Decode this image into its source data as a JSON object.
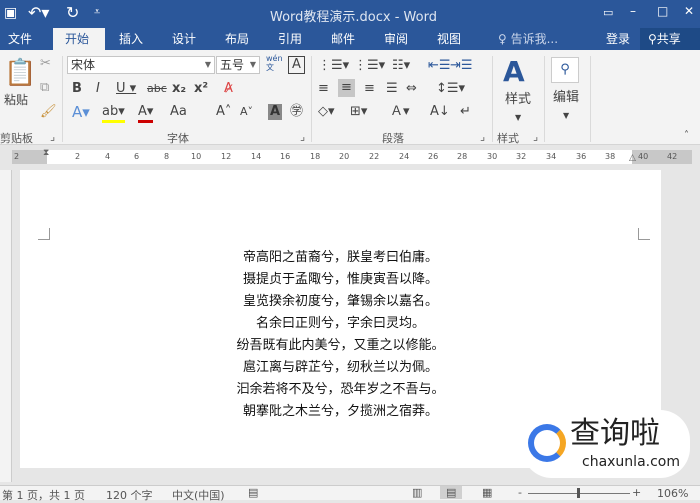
{
  "titlebar": {
    "title": "Word教程演示.docx - Word",
    "save_icon": "save-icon",
    "undo_icon": "undo-icon",
    "redo_icon": "redo-icon",
    "customize_icon": "customize-icon"
  },
  "tabs": [
    {
      "label": "文件"
    },
    {
      "label": "开始"
    },
    {
      "label": "插入"
    },
    {
      "label": "设计"
    },
    {
      "label": "布局"
    },
    {
      "label": "引用"
    },
    {
      "label": "邮件"
    },
    {
      "label": "审阅"
    },
    {
      "label": "视图"
    }
  ],
  "tell_me": "告诉我...",
  "signin": "登录",
  "share": "共享",
  "ribbon": {
    "clipboard": {
      "paste": "粘贴",
      "group": "剪贴板"
    },
    "font": {
      "font_name": "宋体",
      "font_size": "五号",
      "group": "字体",
      "phonetic": "wén\n文",
      "case": "Aa"
    },
    "paragraph": {
      "group": "段落"
    },
    "styles": {
      "label": "样式",
      "group": "样式"
    },
    "editing": {
      "label": "编辑"
    }
  },
  "ruler": {
    "ticks": [
      "2",
      "2",
      "4",
      "6",
      "8",
      "10",
      "12",
      "14",
      "16",
      "18",
      "20",
      "22",
      "24",
      "26",
      "28",
      "30",
      "32",
      "34",
      "36",
      "38",
      "40",
      "42"
    ]
  },
  "document": {
    "lines": [
      "帝高阳之苗裔兮，朕皇考曰伯庸。",
      "摄提贞于孟陬兮，惟庚寅吾以降。",
      "皇览揆余初度兮，肇锡余以嘉名。",
      "名余曰正则兮，字余曰灵均。",
      "纷吾既有此内美兮，又重之以修能。",
      "扈江离与辟芷兮，纫秋兰以为佩。",
      "汩余若将不及兮，恐年岁之不吾与。",
      "朝搴阰之木兰兮，夕揽洲之宿莽。"
    ]
  },
  "status": {
    "page": "第 1 页，共 1 页",
    "words": "120 个字",
    "language": "中文(中国)",
    "zoom": "106%"
  },
  "watermark": {
    "name": "查询啦",
    "url": "chaxunla.com"
  }
}
